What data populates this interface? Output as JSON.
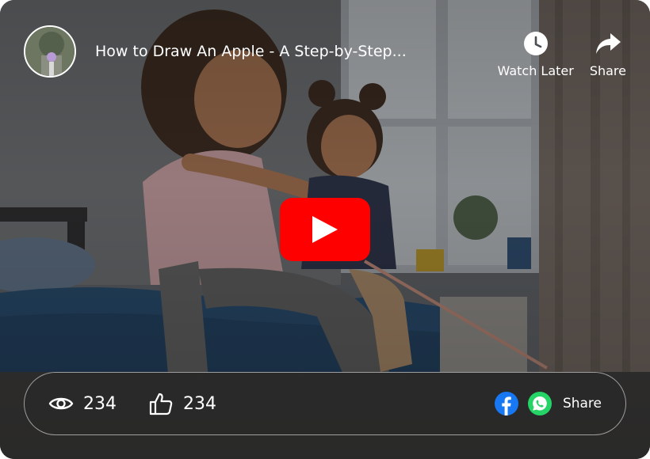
{
  "video": {
    "title": "How to Draw An Apple - A Step-by-Step...",
    "watch_later_label": "Watch Later",
    "share_label": "Share"
  },
  "stats": {
    "views": "234",
    "likes": "234"
  },
  "footer": {
    "share_label": "Share"
  },
  "colors": {
    "play_red": "#FF0000",
    "facebook_blue": "#1877F2",
    "whatsapp_green": "#25D366"
  },
  "icons": {
    "avatar": "channel-avatar",
    "watch_later": "clock-icon",
    "share": "share-arrow-icon",
    "play": "play-icon",
    "views": "eye-icon",
    "likes": "thumbs-up-icon",
    "facebook": "facebook-icon",
    "whatsapp": "whatsapp-icon"
  }
}
